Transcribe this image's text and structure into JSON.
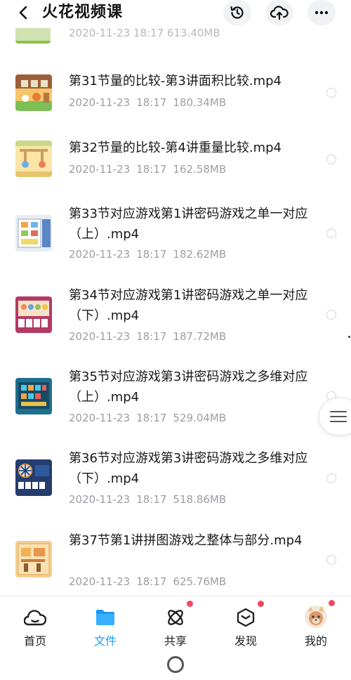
{
  "header": {
    "title": "火花视频课",
    "icons": [
      "back-icon",
      "history-icon",
      "cloud-upload-icon",
      "more-icon"
    ]
  },
  "previous_item": {
    "meta": "2020-11-23  18:17  613.40MB"
  },
  "files": [
    {
      "name": "第31节量的比较-第3讲面积比较.mp4",
      "date": "2020-11-23",
      "time": "18:17",
      "size": "180.34MB"
    },
    {
      "name": "第32节量的比较-第4讲重量比较.mp4",
      "date": "2020-11-23",
      "time": "18:17",
      "size": "162.58MB"
    },
    {
      "name": "第33节对应游戏第1讲密码游戏之单一对应（上）.mp4",
      "date": "2020-11-23",
      "time": "18:17",
      "size": "182.62MB"
    },
    {
      "name": "第34节对应游戏第1讲密码游戏之单一对应（下）.mp4",
      "date": "2020-11-23",
      "time": "18:17",
      "size": "187.72MB"
    },
    {
      "name": "第35节对应游戏第3讲密码游戏之多维对应（上）.mp4",
      "date": "2020-11-23",
      "time": "18:17",
      "size": "529.04MB"
    },
    {
      "name": "第36节对应游戏第3讲密码游戏之多维对应（下）.mp4",
      "date": "2020-11-23",
      "time": "18:17",
      "size": "518.86MB"
    },
    {
      "name": "第37节第1讲拼图游戏之整体与部分.mp4",
      "date": "2020-11-23",
      "time": "18:17",
      "size": "625.76MB"
    }
  ],
  "tabs": [
    {
      "label": "首页",
      "icon": "cloud-home-icon",
      "active": false,
      "badge": false
    },
    {
      "label": "文件",
      "icon": "folder-icon",
      "active": true,
      "badge": false
    },
    {
      "label": "共享",
      "icon": "atom-share-icon",
      "active": false,
      "badge": true
    },
    {
      "label": "发现",
      "icon": "discover-box-icon",
      "active": false,
      "badge": true
    },
    {
      "label": "我的",
      "icon": "avatar-icon",
      "active": false,
      "badge": true
    }
  ],
  "colors": {
    "accent": "#1a9af5",
    "badge": "#f04a63",
    "meta_text": "#9b9ea4"
  }
}
